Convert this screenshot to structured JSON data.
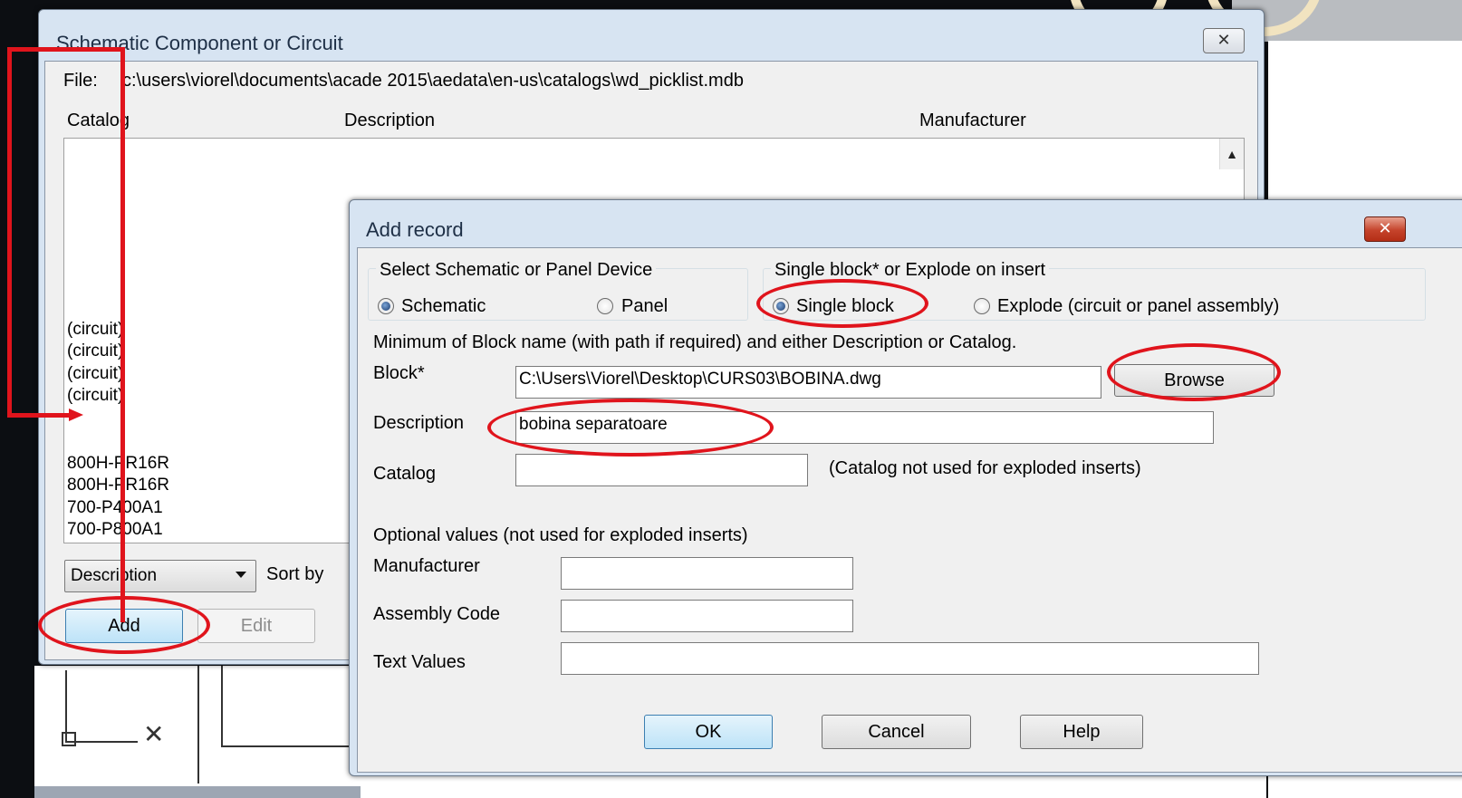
{
  "background": {
    "accent_color": "#f1e3c0"
  },
  "schematic_dialog": {
    "title": "Schematic Component or Circuit",
    "close_symbol": "✕",
    "file_label": "File:",
    "file_path": "c:\\users\\viorel\\documents\\acade 2015\\aedata\\en-us\\catalogs\\wd_picklist.mdb",
    "columns": [
      "Catalog",
      "Description",
      "Manufacturer"
    ],
    "list_rows": [
      "(circuit)",
      "(circuit)",
      "(circuit)",
      "(circuit)",
      "",
      "",
      "800H-PR16R",
      "800H-PR16R",
      "700-P400A1",
      "700-P800A1"
    ],
    "sort_by_value": "Description",
    "sort_by_label": "Sort by",
    "add_label": "Add",
    "edit_label": "Edit"
  },
  "add_record_dialog": {
    "title": "Add record",
    "close_symbol": "✕",
    "device_group": {
      "title": "Select Schematic or Panel Device",
      "options": [
        "Schematic",
        "Panel"
      ],
      "selected": "Schematic"
    },
    "insert_group": {
      "title": "Single block* or Explode on insert",
      "options": [
        "Single block",
        "Explode (circuit or panel assembly)"
      ],
      "selected": "Single block"
    },
    "instructions": "Minimum of Block name (with path if required) and either Description or Catalog.",
    "block_label": "Block*",
    "block_value": "C:\\Users\\Viorel\\Desktop\\CURS03\\BOBINA.dwg",
    "browse_label": "Browse",
    "description_label": "Description",
    "description_value": "bobina separatoare",
    "catalog_label": "Catalog",
    "catalog_value": "",
    "catalog_note": "(Catalog not used for exploded inserts)",
    "optional_title": "Optional values (not used for exploded inserts)",
    "manufacturer_label": "Manufacturer",
    "manufacturer_value": "",
    "assembly_code_label": "Assembly Code",
    "assembly_code_value": "",
    "text_values_label": "Text Values",
    "text_values_value": "",
    "ok_label": "OK",
    "cancel_label": "Cancel",
    "help_label": "Help"
  },
  "annotation_color": "#e0141c"
}
